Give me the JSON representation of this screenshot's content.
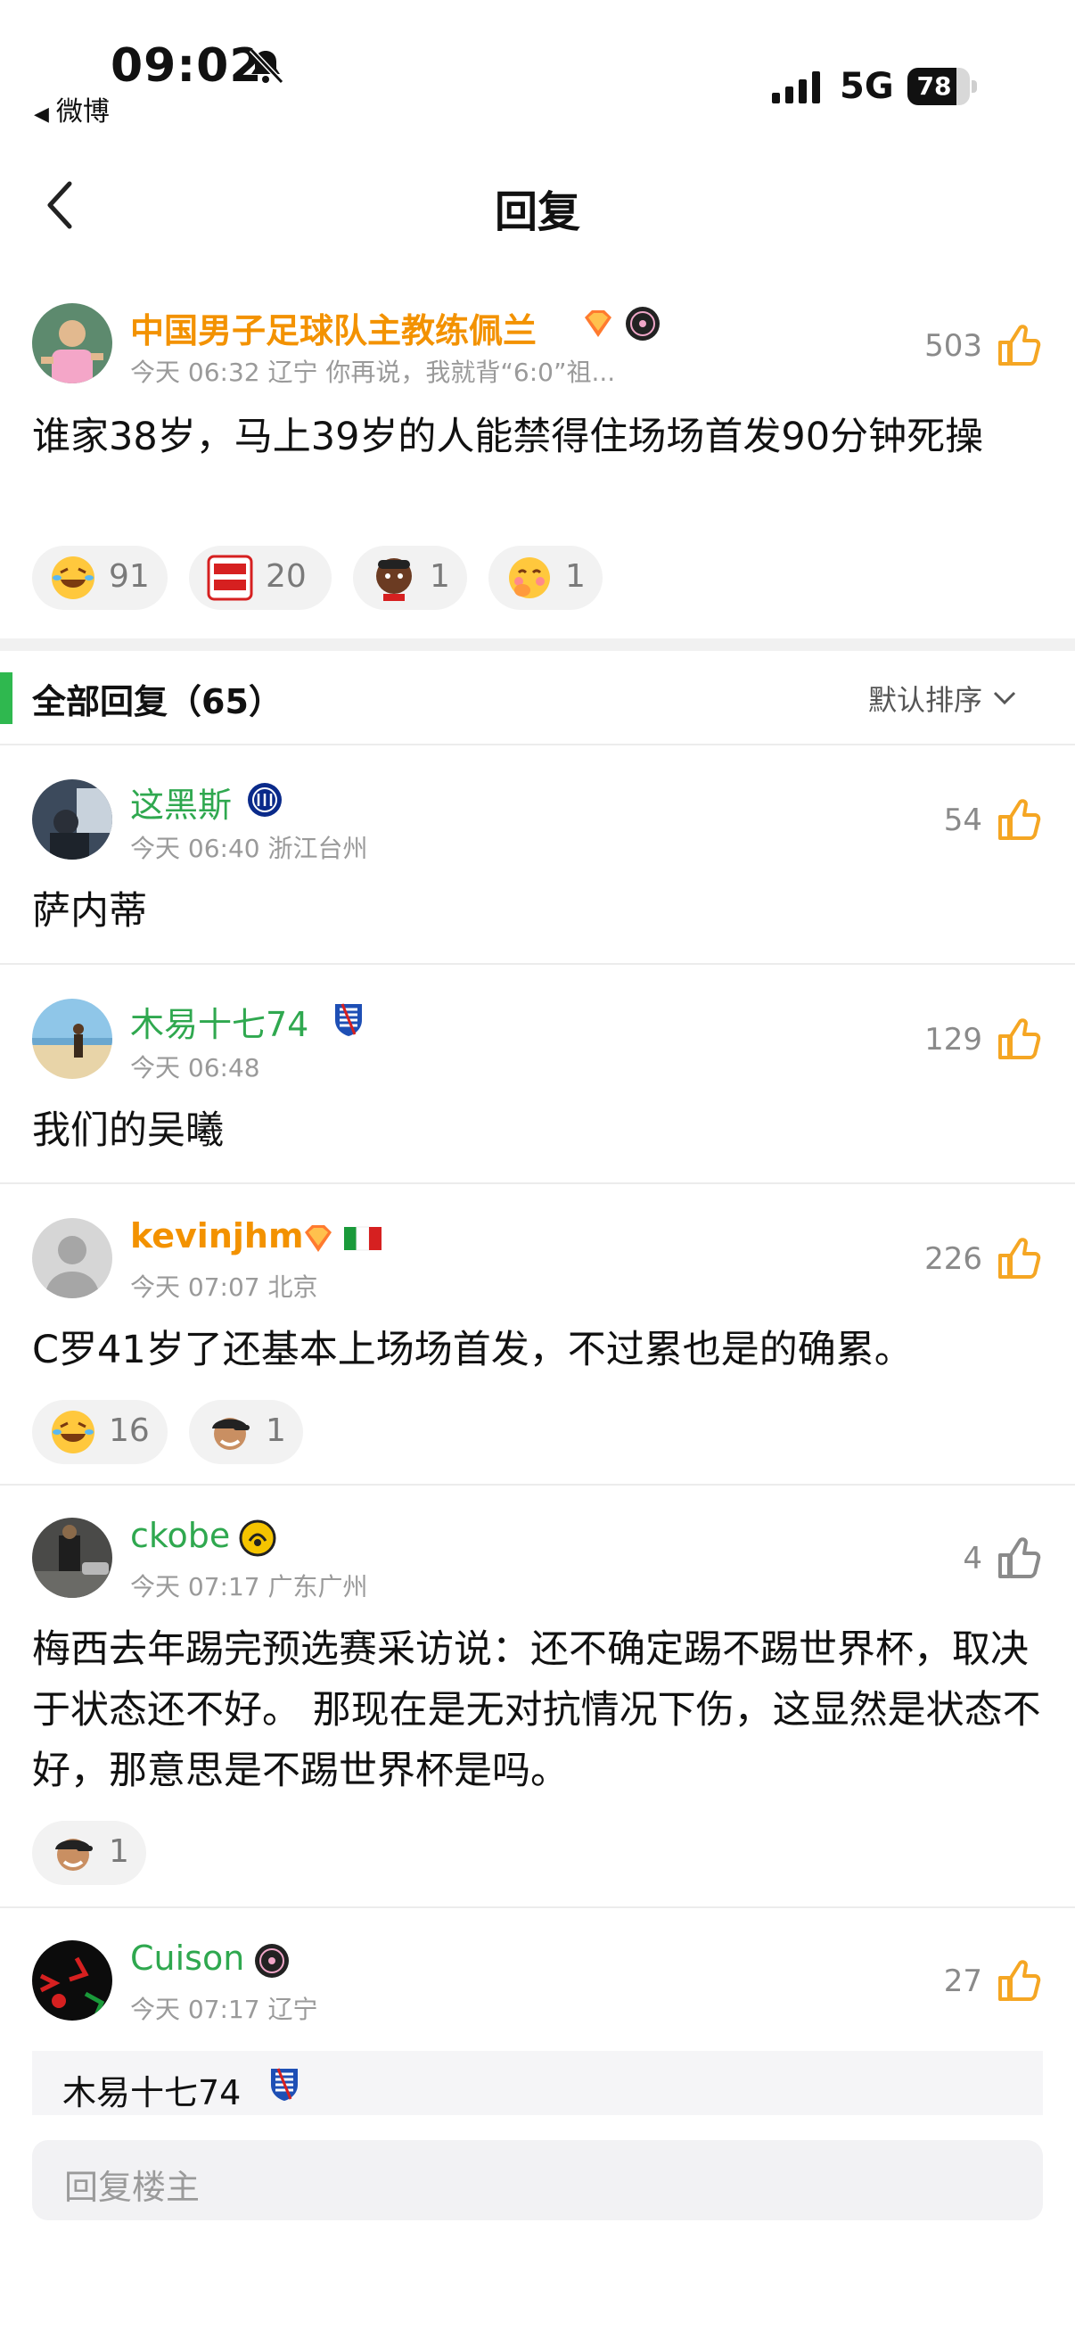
{
  "status_bar": {
    "time": "09:02",
    "back_app": "微博",
    "network": "5G",
    "battery": "78",
    "battery_level": 0.78
  },
  "nav": {
    "title": "回复"
  },
  "main_post": {
    "username": "中国男子足球队主教练佩兰",
    "meta": "今天 06:32 辽宁 你再说，我就背“6:0”祖...",
    "likes": "503",
    "text": "谁家38岁，马上39岁的人能禁得住场场首发90分钟死操",
    "reactions": [
      {
        "icon": "laughing-tears-emoji",
        "count": "91"
      },
      {
        "icon": "justice-wins-sticker",
        "count": "20"
      },
      {
        "icon": "player-face-sticker",
        "count": "1"
      },
      {
        "icon": "blushing-wave-emoji",
        "count": "1"
      }
    ]
  },
  "replies_header": {
    "title": "全部回复（65）",
    "sort": "默认排序"
  },
  "replies": [
    {
      "username": "这黑斯",
      "meta": "今天 06:40 浙江台州",
      "likes": "54",
      "text": "萨内蒂"
    },
    {
      "username": "木易十七74",
      "meta": "今天 06:48",
      "likes": "129",
      "text": "我们的吴曦"
    },
    {
      "username": "kevinjhm",
      "meta": "今天 07:07 北京",
      "likes": "226",
      "text": "C罗41岁了还基本上场场首发，不过累也是的确累。",
      "reactions": [
        {
          "icon": "laughing-tears-emoji",
          "count": "16"
        },
        {
          "icon": "cap-face-sticker",
          "count": "1"
        }
      ]
    },
    {
      "username": "ckobe",
      "meta": "今天 07:17 广东广州",
      "likes": "4",
      "text": "梅西去年踢完预选赛采访说：还不确定踢不踢世界杯，取决于状态还不好。 那现在是无对抗情况下伤，这显然是状态不好，那意思是不踢世界杯是吗。",
      "reactions": [
        {
          "icon": "cap-face-sticker",
          "count": "1"
        }
      ]
    },
    {
      "username": "Cuison",
      "meta": "今天 07:17 辽宁",
      "likes": "27",
      "quoted_user": "木易十七74"
    }
  ],
  "reply_input": {
    "placeholder": "回复楼主"
  },
  "colors": {
    "accent_orange": "#f39200",
    "name_green": "#2fa84f",
    "section_bar": "#2fb84f",
    "like_orange": "#f5a623"
  }
}
